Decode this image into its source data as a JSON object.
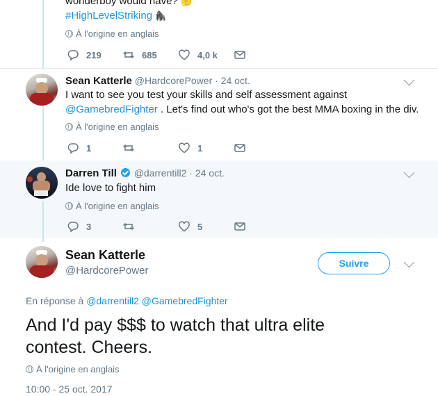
{
  "tweet1": {
    "text_partial": "wonderboy would have?",
    "emoji_top": "🤔",
    "hashtag": "#HighLevelStriking",
    "emoji": "🦍",
    "translate": "À l'origine en anglais",
    "replies": "219",
    "retweets": "685",
    "likes": "4,0 k"
  },
  "tweet2": {
    "name": "Sean Katterle",
    "handle": "@HardcorePower",
    "date": "· 24 oct.",
    "text_line1": "I want to see you test your skills and self assessment against",
    "mention": "@GamebredFighter",
    "text_line2_rest": " . Let's find out who's got the best MMA boxing in the div.",
    "translate": "À l'origine en anglais",
    "replies": "1",
    "retweets": "",
    "likes": "1"
  },
  "tweet3": {
    "name": "Darren Till",
    "handle": "@darrentill2",
    "date": "· 24 oct.",
    "text": "Ide love to fight him",
    "translate": "À l'origine en anglais",
    "replies": "3",
    "retweets": "",
    "likes": "5"
  },
  "main": {
    "name": "Sean Katterle",
    "handle": "@HardcorePower",
    "follow_label": "Suivre",
    "reply_prefix": "En réponse à",
    "reply_to_1": "@darrentill2",
    "reply_to_2": "@GamebredFighter",
    "text_line1": "And I'd pay $$$ to watch that ultra elite",
    "text_line2": "contest. Cheers.",
    "translate": "À l'origine en anglais",
    "timestamp": "10:00 - 25 oct. 2017"
  },
  "colors": {
    "link": "#1b95e0",
    "muted": "#657786",
    "thread": "#c4e4f7",
    "highlight": "#f5f8fa"
  }
}
